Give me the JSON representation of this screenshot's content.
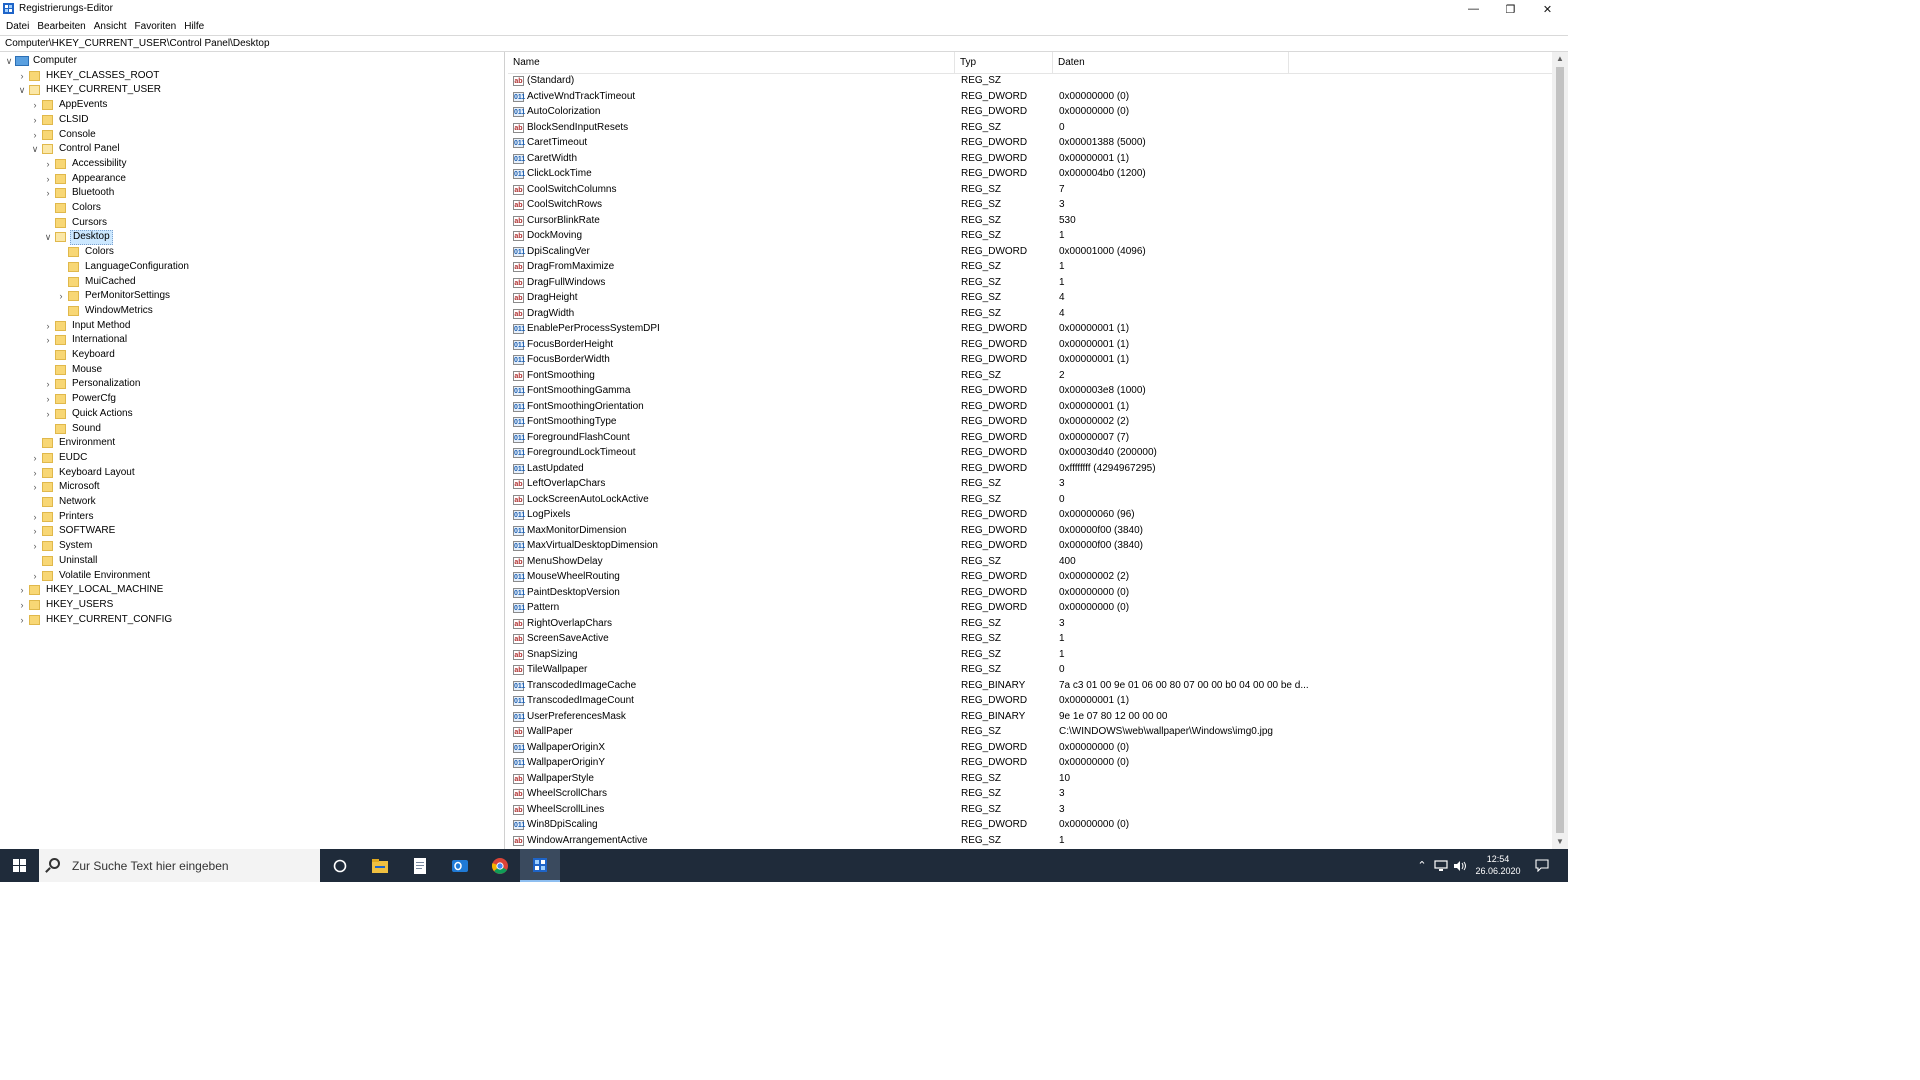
{
  "window": {
    "title": "Registrierungs-Editor",
    "controls": {
      "minimize": "—",
      "restore": "❐",
      "close": "✕"
    }
  },
  "menu": [
    "Datei",
    "Bearbeiten",
    "Ansicht",
    "Favoriten",
    "Hilfe"
  ],
  "address": "Computer\\HKEY_CURRENT_USER\\Control Panel\\Desktop",
  "tree": [
    {
      "label": "Computer",
      "level": 0,
      "expander": "open",
      "icon": "computer-icon"
    },
    {
      "label": "HKEY_CLASSES_ROOT",
      "level": 1,
      "expander": "closed"
    },
    {
      "label": "HKEY_CURRENT_USER",
      "level": 1,
      "expander": "open"
    },
    {
      "label": "AppEvents",
      "level": 2,
      "expander": "closed"
    },
    {
      "label": "CLSID",
      "level": 2,
      "expander": "closed"
    },
    {
      "label": "Console",
      "level": 2,
      "expander": "closed"
    },
    {
      "label": "Control Panel",
      "level": 2,
      "expander": "open"
    },
    {
      "label": "Accessibility",
      "level": 3,
      "expander": "closed"
    },
    {
      "label": "Appearance",
      "level": 3,
      "expander": "closed"
    },
    {
      "label": "Bluetooth",
      "level": 3,
      "expander": "closed"
    },
    {
      "label": "Colors",
      "level": 3,
      "expander": "none"
    },
    {
      "label": "Cursors",
      "level": 3,
      "expander": "none"
    },
    {
      "label": "Desktop",
      "level": 3,
      "expander": "open",
      "selected": true
    },
    {
      "label": "Colors",
      "level": 4,
      "expander": "none"
    },
    {
      "label": "LanguageConfiguration",
      "level": 4,
      "expander": "none"
    },
    {
      "label": "MuiCached",
      "level": 4,
      "expander": "none"
    },
    {
      "label": "PerMonitorSettings",
      "level": 4,
      "expander": "closed"
    },
    {
      "label": "WindowMetrics",
      "level": 4,
      "expander": "none"
    },
    {
      "label": "Input Method",
      "level": 3,
      "expander": "closed"
    },
    {
      "label": "International",
      "level": 3,
      "expander": "closed"
    },
    {
      "label": "Keyboard",
      "level": 3,
      "expander": "none"
    },
    {
      "label": "Mouse",
      "level": 3,
      "expander": "none"
    },
    {
      "label": "Personalization",
      "level": 3,
      "expander": "closed"
    },
    {
      "label": "PowerCfg",
      "level": 3,
      "expander": "closed"
    },
    {
      "label": "Quick Actions",
      "level": 3,
      "expander": "closed"
    },
    {
      "label": "Sound",
      "level": 3,
      "expander": "none"
    },
    {
      "label": "Environment",
      "level": 2,
      "expander": "none"
    },
    {
      "label": "EUDC",
      "level": 2,
      "expander": "closed"
    },
    {
      "label": "Keyboard Layout",
      "level": 2,
      "expander": "closed"
    },
    {
      "label": "Microsoft",
      "level": 2,
      "expander": "closed"
    },
    {
      "label": "Network",
      "level": 2,
      "expander": "none"
    },
    {
      "label": "Printers",
      "level": 2,
      "expander": "closed"
    },
    {
      "label": "SOFTWARE",
      "level": 2,
      "expander": "closed"
    },
    {
      "label": "System",
      "level": 2,
      "expander": "closed"
    },
    {
      "label": "Uninstall",
      "level": 2,
      "expander": "none"
    },
    {
      "label": "Volatile Environment",
      "level": 2,
      "expander": "closed"
    },
    {
      "label": "HKEY_LOCAL_MACHINE",
      "level": 1,
      "expander": "closed"
    },
    {
      "label": "HKEY_USERS",
      "level": 1,
      "expander": "closed"
    },
    {
      "label": "HKEY_CURRENT_CONFIG",
      "level": 1,
      "expander": "closed"
    }
  ],
  "columns": {
    "name": "Name",
    "typ": "Typ",
    "daten": "Daten"
  },
  "values": [
    {
      "name": "(Standard)",
      "type": "REG_SZ",
      "data": "",
      "icon": "sz"
    },
    {
      "name": "ActiveWndTrackTimeout",
      "type": "REG_DWORD",
      "data": "0x00000000 (0)",
      "icon": "bin"
    },
    {
      "name": "AutoColorization",
      "type": "REG_DWORD",
      "data": "0x00000000 (0)",
      "icon": "bin"
    },
    {
      "name": "BlockSendInputResets",
      "type": "REG_SZ",
      "data": "0",
      "icon": "sz"
    },
    {
      "name": "CaretTimeout",
      "type": "REG_DWORD",
      "data": "0x00001388 (5000)",
      "icon": "bin"
    },
    {
      "name": "CaretWidth",
      "type": "REG_DWORD",
      "data": "0x00000001 (1)",
      "icon": "bin"
    },
    {
      "name": "ClickLockTime",
      "type": "REG_DWORD",
      "data": "0x000004b0 (1200)",
      "icon": "bin"
    },
    {
      "name": "CoolSwitchColumns",
      "type": "REG_SZ",
      "data": "7",
      "icon": "sz"
    },
    {
      "name": "CoolSwitchRows",
      "type": "REG_SZ",
      "data": "3",
      "icon": "sz"
    },
    {
      "name": "CursorBlinkRate",
      "type": "REG_SZ",
      "data": "530",
      "icon": "sz"
    },
    {
      "name": "DockMoving",
      "type": "REG_SZ",
      "data": "1",
      "icon": "sz"
    },
    {
      "name": "DpiScalingVer",
      "type": "REG_DWORD",
      "data": "0x00001000 (4096)",
      "icon": "bin"
    },
    {
      "name": "DragFromMaximize",
      "type": "REG_SZ",
      "data": "1",
      "icon": "sz"
    },
    {
      "name": "DragFullWindows",
      "type": "REG_SZ",
      "data": "1",
      "icon": "sz"
    },
    {
      "name": "DragHeight",
      "type": "REG_SZ",
      "data": "4",
      "icon": "sz"
    },
    {
      "name": "DragWidth",
      "type": "REG_SZ",
      "data": "4",
      "icon": "sz"
    },
    {
      "name": "EnablePerProcessSystemDPI",
      "type": "REG_DWORD",
      "data": "0x00000001 (1)",
      "icon": "bin"
    },
    {
      "name": "FocusBorderHeight",
      "type": "REG_DWORD",
      "data": "0x00000001 (1)",
      "icon": "bin"
    },
    {
      "name": "FocusBorderWidth",
      "type": "REG_DWORD",
      "data": "0x00000001 (1)",
      "icon": "bin"
    },
    {
      "name": "FontSmoothing",
      "type": "REG_SZ",
      "data": "2",
      "icon": "sz"
    },
    {
      "name": "FontSmoothingGamma",
      "type": "REG_DWORD",
      "data": "0x000003e8 (1000)",
      "icon": "bin"
    },
    {
      "name": "FontSmoothingOrientation",
      "type": "REG_DWORD",
      "data": "0x00000001 (1)",
      "icon": "bin"
    },
    {
      "name": "FontSmoothingType",
      "type": "REG_DWORD",
      "data": "0x00000002 (2)",
      "icon": "bin"
    },
    {
      "name": "ForegroundFlashCount",
      "type": "REG_DWORD",
      "data": "0x00000007 (7)",
      "icon": "bin"
    },
    {
      "name": "ForegroundLockTimeout",
      "type": "REG_DWORD",
      "data": "0x00030d40 (200000)",
      "icon": "bin"
    },
    {
      "name": "LastUpdated",
      "type": "REG_DWORD",
      "data": "0xffffffff (4294967295)",
      "icon": "bin"
    },
    {
      "name": "LeftOverlapChars",
      "type": "REG_SZ",
      "data": "3",
      "icon": "sz"
    },
    {
      "name": "LockScreenAutoLockActive",
      "type": "REG_SZ",
      "data": "0",
      "icon": "sz"
    },
    {
      "name": "LogPixels",
      "type": "REG_DWORD",
      "data": "0x00000060 (96)",
      "icon": "bin"
    },
    {
      "name": "MaxMonitorDimension",
      "type": "REG_DWORD",
      "data": "0x00000f00 (3840)",
      "icon": "bin"
    },
    {
      "name": "MaxVirtualDesktopDimension",
      "type": "REG_DWORD",
      "data": "0x00000f00 (3840)",
      "icon": "bin"
    },
    {
      "name": "MenuShowDelay",
      "type": "REG_SZ",
      "data": "400",
      "icon": "sz"
    },
    {
      "name": "MouseWheelRouting",
      "type": "REG_DWORD",
      "data": "0x00000002 (2)",
      "icon": "bin"
    },
    {
      "name": "PaintDesktopVersion",
      "type": "REG_DWORD",
      "data": "0x00000000 (0)",
      "icon": "bin"
    },
    {
      "name": "Pattern",
      "type": "REG_DWORD",
      "data": "0x00000000 (0)",
      "icon": "bin"
    },
    {
      "name": "RightOverlapChars",
      "type": "REG_SZ",
      "data": "3",
      "icon": "sz"
    },
    {
      "name": "ScreenSaveActive",
      "type": "REG_SZ",
      "data": "1",
      "icon": "sz"
    },
    {
      "name": "SnapSizing",
      "type": "REG_SZ",
      "data": "1",
      "icon": "sz"
    },
    {
      "name": "TileWallpaper",
      "type": "REG_SZ",
      "data": "0",
      "icon": "sz"
    },
    {
      "name": "TranscodedImageCache",
      "type": "REG_BINARY",
      "data": "7a c3 01 00 9e 01 06 00 80 07 00 00 b0 04 00 00 be d...",
      "icon": "bin"
    },
    {
      "name": "TranscodedImageCount",
      "type": "REG_DWORD",
      "data": "0x00000001 (1)",
      "icon": "bin"
    },
    {
      "name": "UserPreferencesMask",
      "type": "REG_BINARY",
      "data": "9e 1e 07 80 12 00 00 00",
      "icon": "bin"
    },
    {
      "name": "WallPaper",
      "type": "REG_SZ",
      "data": "C:\\WINDOWS\\web\\wallpaper\\Windows\\img0.jpg",
      "icon": "sz"
    },
    {
      "name": "WallpaperOriginX",
      "type": "REG_DWORD",
      "data": "0x00000000 (0)",
      "icon": "bin"
    },
    {
      "name": "WallpaperOriginY",
      "type": "REG_DWORD",
      "data": "0x00000000 (0)",
      "icon": "bin"
    },
    {
      "name": "WallpaperStyle",
      "type": "REG_SZ",
      "data": "10",
      "icon": "sz"
    },
    {
      "name": "WheelScrollChars",
      "type": "REG_SZ",
      "data": "3",
      "icon": "sz"
    },
    {
      "name": "WheelScrollLines",
      "type": "REG_SZ",
      "data": "3",
      "icon": "sz"
    },
    {
      "name": "Win8DpiScaling",
      "type": "REG_DWORD",
      "data": "0x00000000 (0)",
      "icon": "bin"
    },
    {
      "name": "WindowArrangementActive",
      "type": "REG_SZ",
      "data": "1",
      "icon": "sz"
    }
  ],
  "taskbar": {
    "search_placeholder": "Zur Suche Text hier eingeben",
    "apps": [
      "task-view-icon",
      "file-explorer-icon",
      "notepad-icon",
      "outlook-icon",
      "chrome-icon",
      "regedit-icon"
    ],
    "clock_time": "12:54",
    "clock_date": "26.06.2020"
  }
}
